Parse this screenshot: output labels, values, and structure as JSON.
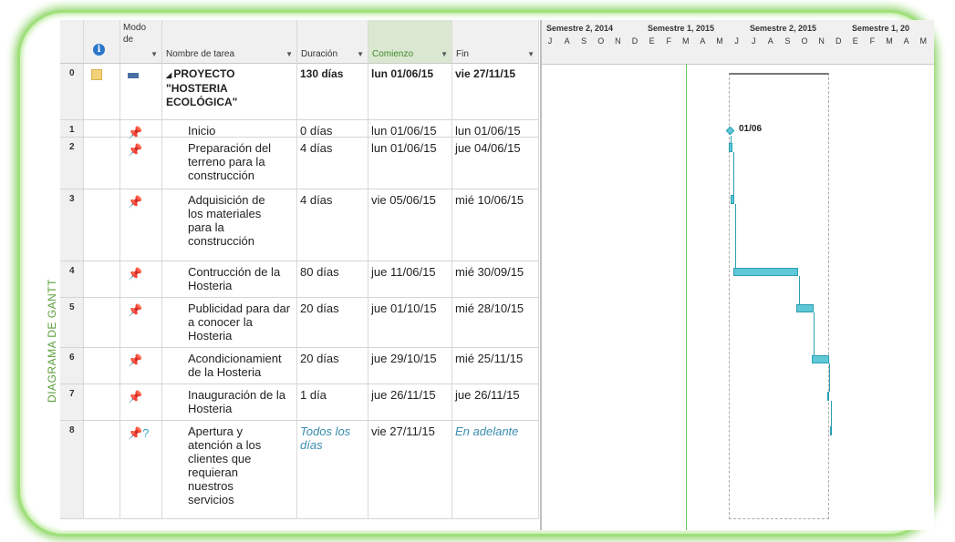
{
  "side_label": "DIAGRAMA DE GANTT",
  "columns": {
    "modo": "Modo de",
    "nombre": "Nombre de tarea",
    "duracion": "Duración",
    "comienzo": "Comienzo",
    "fin": "Fin"
  },
  "tasks": [
    {
      "id": "0",
      "name": "PROYECTO \"HOSTERIA ECOLÓGICA\"",
      "duration": "130 días",
      "start": "lun 01/06/15",
      "end": "vie 27/11/15"
    },
    {
      "id": "1",
      "name": "Inicio",
      "duration": "0 días",
      "start": "lun 01/06/15",
      "end": "lun 01/06/15"
    },
    {
      "id": "2",
      "name": "Preparación del terreno para la construcción",
      "duration": "4 días",
      "start": "lun 01/06/15",
      "end": "jue 04/06/15"
    },
    {
      "id": "3",
      "name": "Adquisición de los materiales para la construcción",
      "duration": "4 días",
      "start": "vie 05/06/15",
      "end": "mié 10/06/15"
    },
    {
      "id": "4",
      "name": "Contrucción de la Hosteria",
      "duration": "80 días",
      "start": "jue 11/06/15",
      "end": "mié 30/09/15"
    },
    {
      "id": "5",
      "name": "Publicidad para dar a conocer la Hosteria",
      "duration": "20 días",
      "start": "jue 01/10/15",
      "end": "mié 28/10/15"
    },
    {
      "id": "6",
      "name": "Acondicionamient de la Hosteria",
      "duration": "20 días",
      "start": "jue 29/10/15",
      "end": "mié 25/11/15"
    },
    {
      "id": "7",
      "name": "Inauguración de la Hosteria",
      "duration": "1 día",
      "start": "jue 26/11/15",
      "end": "jue 26/11/15"
    },
    {
      "id": "8",
      "name": "Apertura y atención a los clientes que requieran nuestros servicios",
      "duration": "Todos los días",
      "start": "vie 27/11/15",
      "end": "En adelante"
    }
  ],
  "timescale": {
    "semesters": [
      "Semestre 2, 2014",
      "Semestre 1, 2015",
      "Semestre 2, 2015",
      "Semestre 1, 20"
    ],
    "months": [
      "J",
      "A",
      "S",
      "O",
      "N",
      "D",
      "E",
      "F",
      "M",
      "A",
      "M",
      "J",
      "J",
      "A",
      "S",
      "O",
      "N",
      "D",
      "E",
      "F",
      "M",
      "A",
      "M"
    ]
  },
  "milestone_label": "01/06",
  "colors": {
    "bar": "#5fc7d6",
    "bar_border": "#2b9fb3",
    "frame_glow": "#8fd46a",
    "selected_header": "#dbe8d1"
  }
}
